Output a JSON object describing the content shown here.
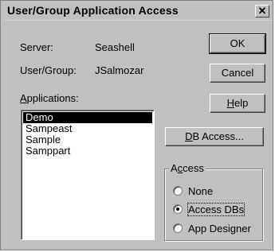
{
  "window": {
    "title": "User/Group Application Access",
    "close_label": "✕"
  },
  "info": {
    "server_label": "Server:",
    "server_value": "Seashell",
    "user_group_label": "User/Group:",
    "user_group_value": "JSalmozar"
  },
  "applications": {
    "label_underlined": "A",
    "label_rest": "pplications:",
    "items": [
      "Demo",
      "Sampeast",
      "Sample",
      "Samppart"
    ],
    "selected": "Demo"
  },
  "buttons": {
    "ok": "OK",
    "cancel": "Cancel",
    "help_underlined": "H",
    "help_rest": "elp",
    "db_access_underlined": "D",
    "db_access_rest": "B Access..."
  },
  "access": {
    "group_label_pre": "A",
    "group_label_underlined": "c",
    "group_label_rest": "cess",
    "options": [
      "None",
      "Access DBs",
      "App Designer"
    ],
    "selected": "Access DBs"
  }
}
